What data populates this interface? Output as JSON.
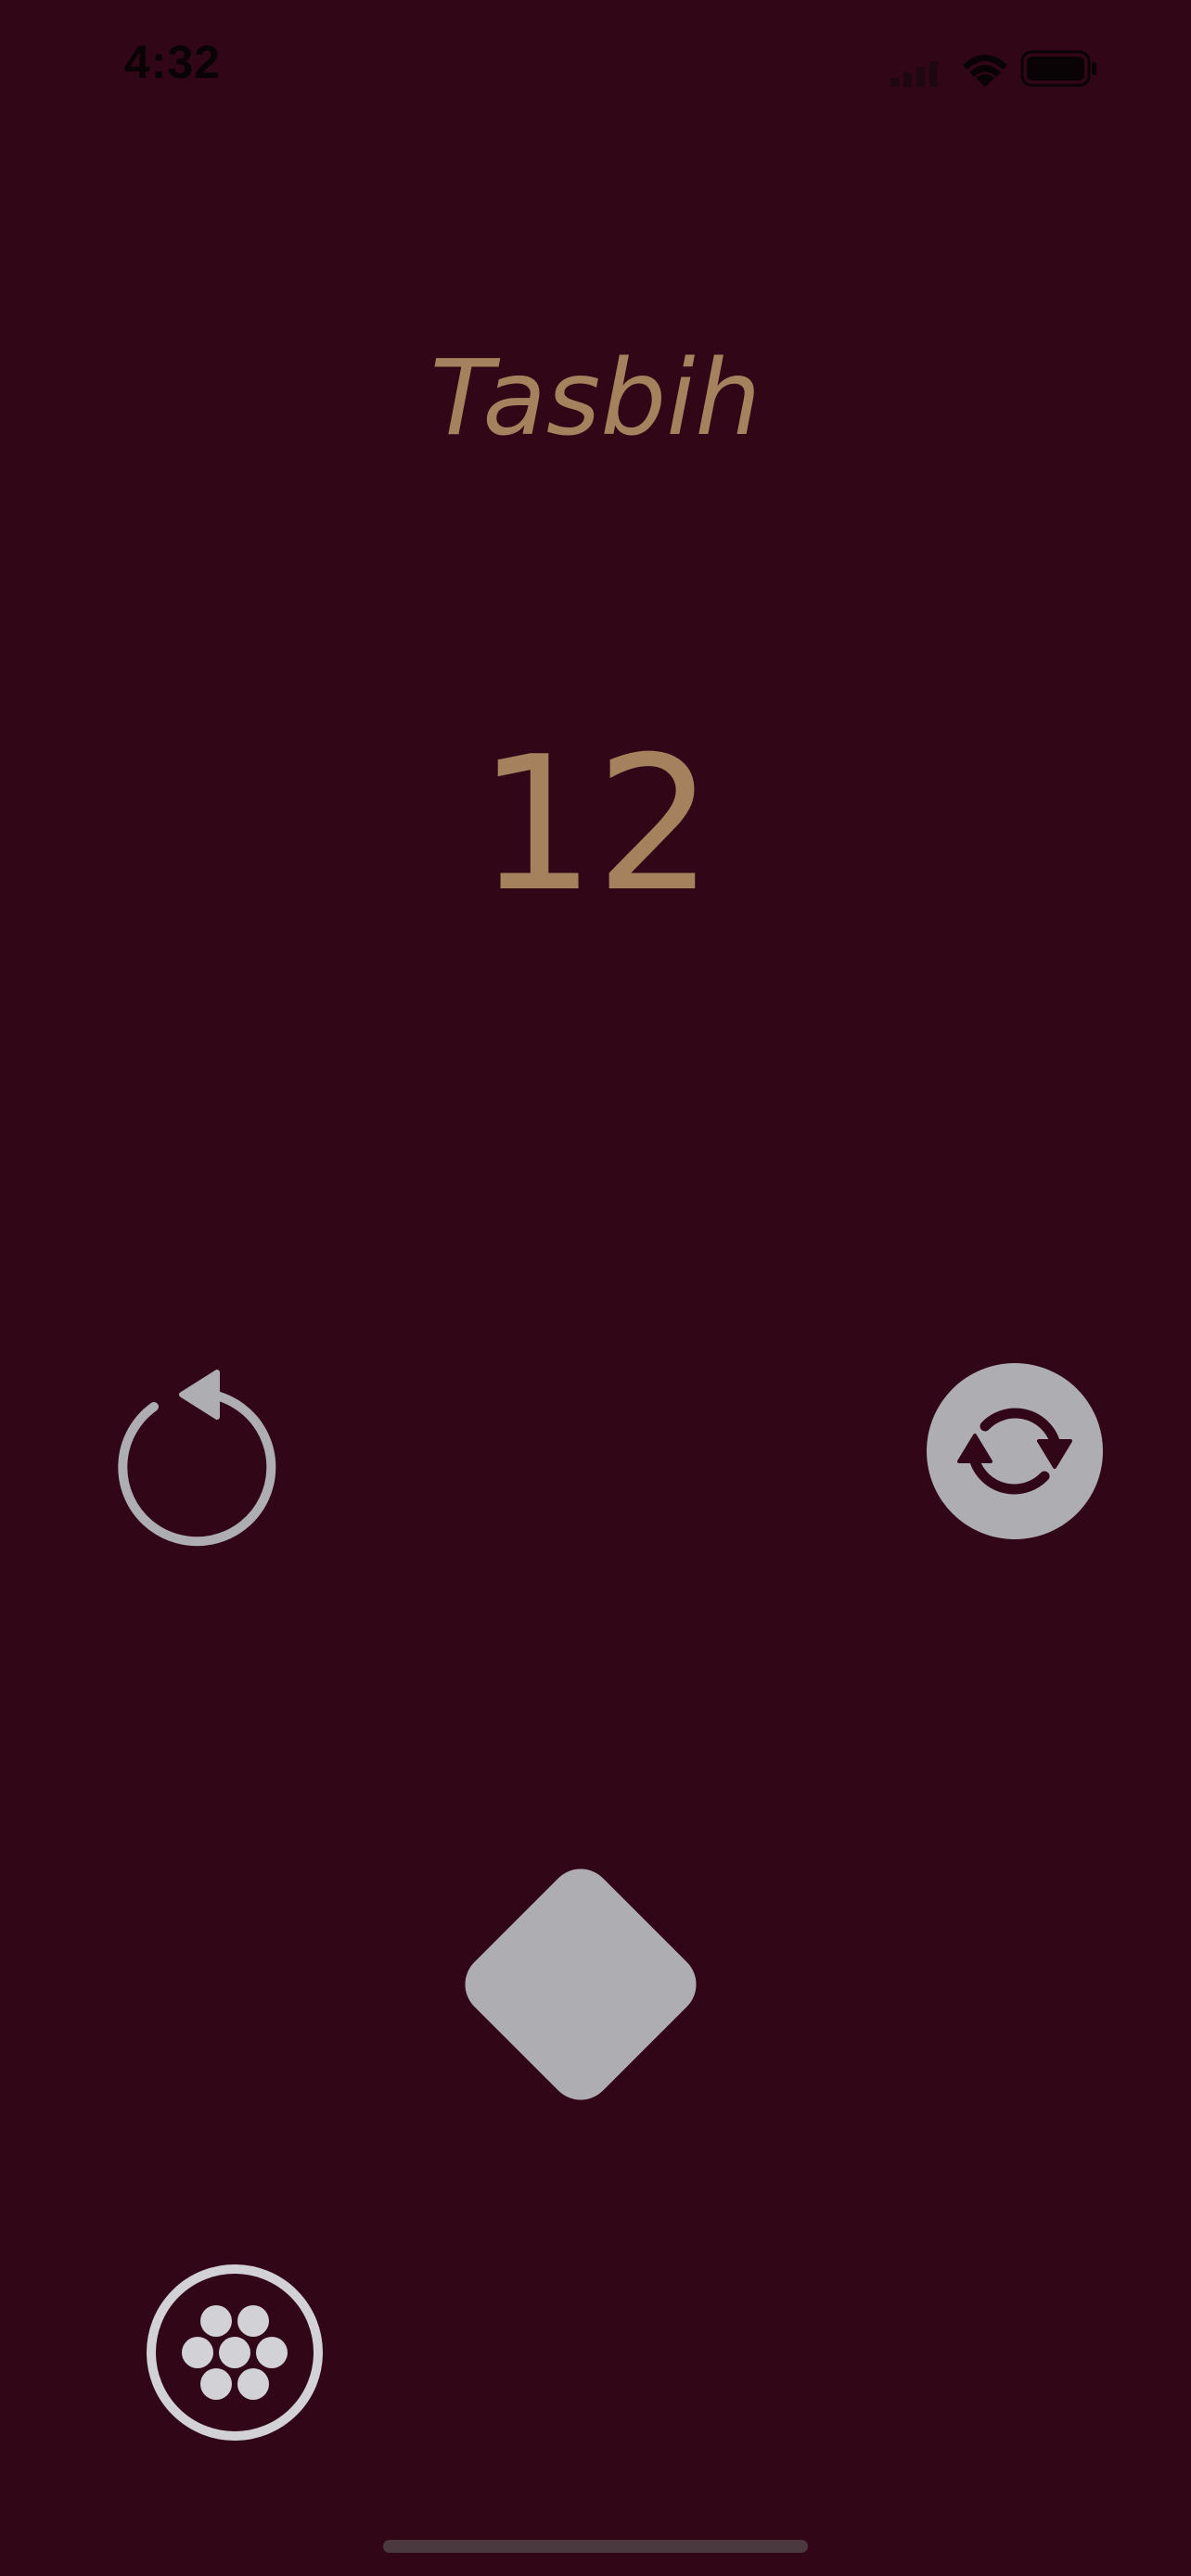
{
  "status_bar": {
    "time": "4:32",
    "icons": [
      "cellular-signal-icon",
      "wifi-icon",
      "battery-icon"
    ]
  },
  "app": {
    "title": "Tasbih",
    "count": "12"
  },
  "controls": {
    "reset_icon": "reset-counter-icon",
    "cycle_icon": "cycle-dhikr-icon",
    "tap_icon": "tap-diamond-icon",
    "beads_icon": "prayer-beads-icon"
  },
  "colors": {
    "background": "#310717",
    "accent_text": "#a5815d",
    "icon_gray": "#aeaeb2"
  }
}
